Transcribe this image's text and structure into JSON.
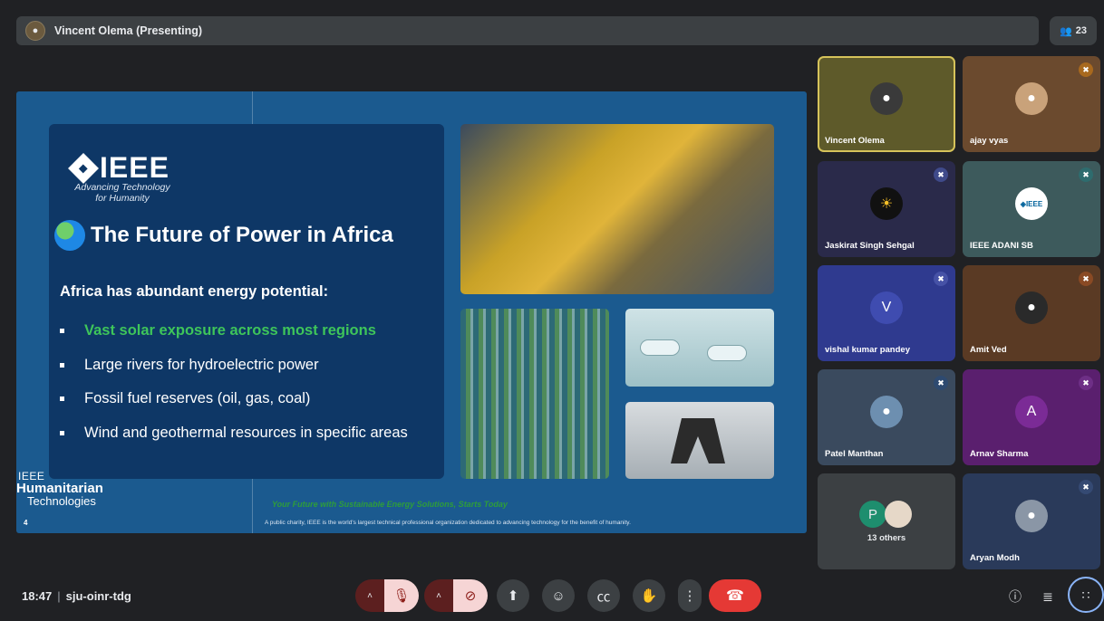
{
  "header": {
    "presenter_label": "Vincent Olema (Presenting)",
    "people_count": "23"
  },
  "slide": {
    "logo_text": "IEEE",
    "logo_tagline": "Advancing Technology for Humanity",
    "title": "The Future of Power in Africa",
    "subtitle": "Africa has abundant energy potential:",
    "bullets": [
      "Vast solar exposure across most regions",
      "Large rivers for hydroelectric power",
      "Fossil fuel reserves (oil, gas, coal)",
      "Wind and geothermal resources in specific areas"
    ],
    "hum_logo_line1": "IEEE",
    "hum_logo_line2": "Humanitarian",
    "hum_logo_line3": "Technologies",
    "tagline": "Your Future with Sustainable Energy Solutions, Starts Today",
    "page_number": "4",
    "footer": "A public charity, IEEE is the world's largest technical professional organization dedicated to advancing technology for the benefit of humanity."
  },
  "participants": [
    {
      "name": "Vincent Olema",
      "initial": "",
      "muted": false,
      "bg": "#6b6a2e"
    },
    {
      "name": "ajay vyas",
      "initial": "",
      "muted": true,
      "bg": "#6b4a2e"
    },
    {
      "name": "Jaskirat Singh Sehgal",
      "initial": "",
      "muted": true,
      "bg": "#2a2a4a"
    },
    {
      "name": "IEEE ADANI SB",
      "initial": "",
      "muted": true,
      "bg": "#3d5a5c"
    },
    {
      "name": "vishal kumar pandey",
      "initial": "V",
      "muted": true,
      "bg": "#2f3a8f"
    },
    {
      "name": "Amit Ved",
      "initial": "",
      "muted": true,
      "bg": "#5a3a24"
    },
    {
      "name": "Patel Manthan",
      "initial": "",
      "muted": true,
      "bg": "#3a4a5e"
    },
    {
      "name": "Arnav Sharma",
      "initial": "A",
      "muted": true,
      "bg": "#5a1f6e"
    },
    {
      "name": "Aryan Modh",
      "initial": "",
      "muted": true,
      "bg": "#2a3a5a"
    }
  ],
  "others": {
    "initial": "P",
    "label": "13 others"
  },
  "ieee_badge": "◈IEEE",
  "meeting": {
    "time": "18:47",
    "code": "sju-oinr-tdg"
  },
  "icons": {
    "caret": "˄",
    "mic_off": "🎙",
    "cam_off": "⊘",
    "present": "⬆",
    "emoji": "☺",
    "captions": "㏄",
    "hand": "✋",
    "more": "⋮",
    "end": "☎",
    "info": "ⓘ",
    "chat": "≣",
    "apps": "∷",
    "mute": "✖"
  },
  "colors": {
    "end_call": "#e53935",
    "active_speaker": "#d6c35a",
    "highlight_text": "#3ec55a"
  }
}
